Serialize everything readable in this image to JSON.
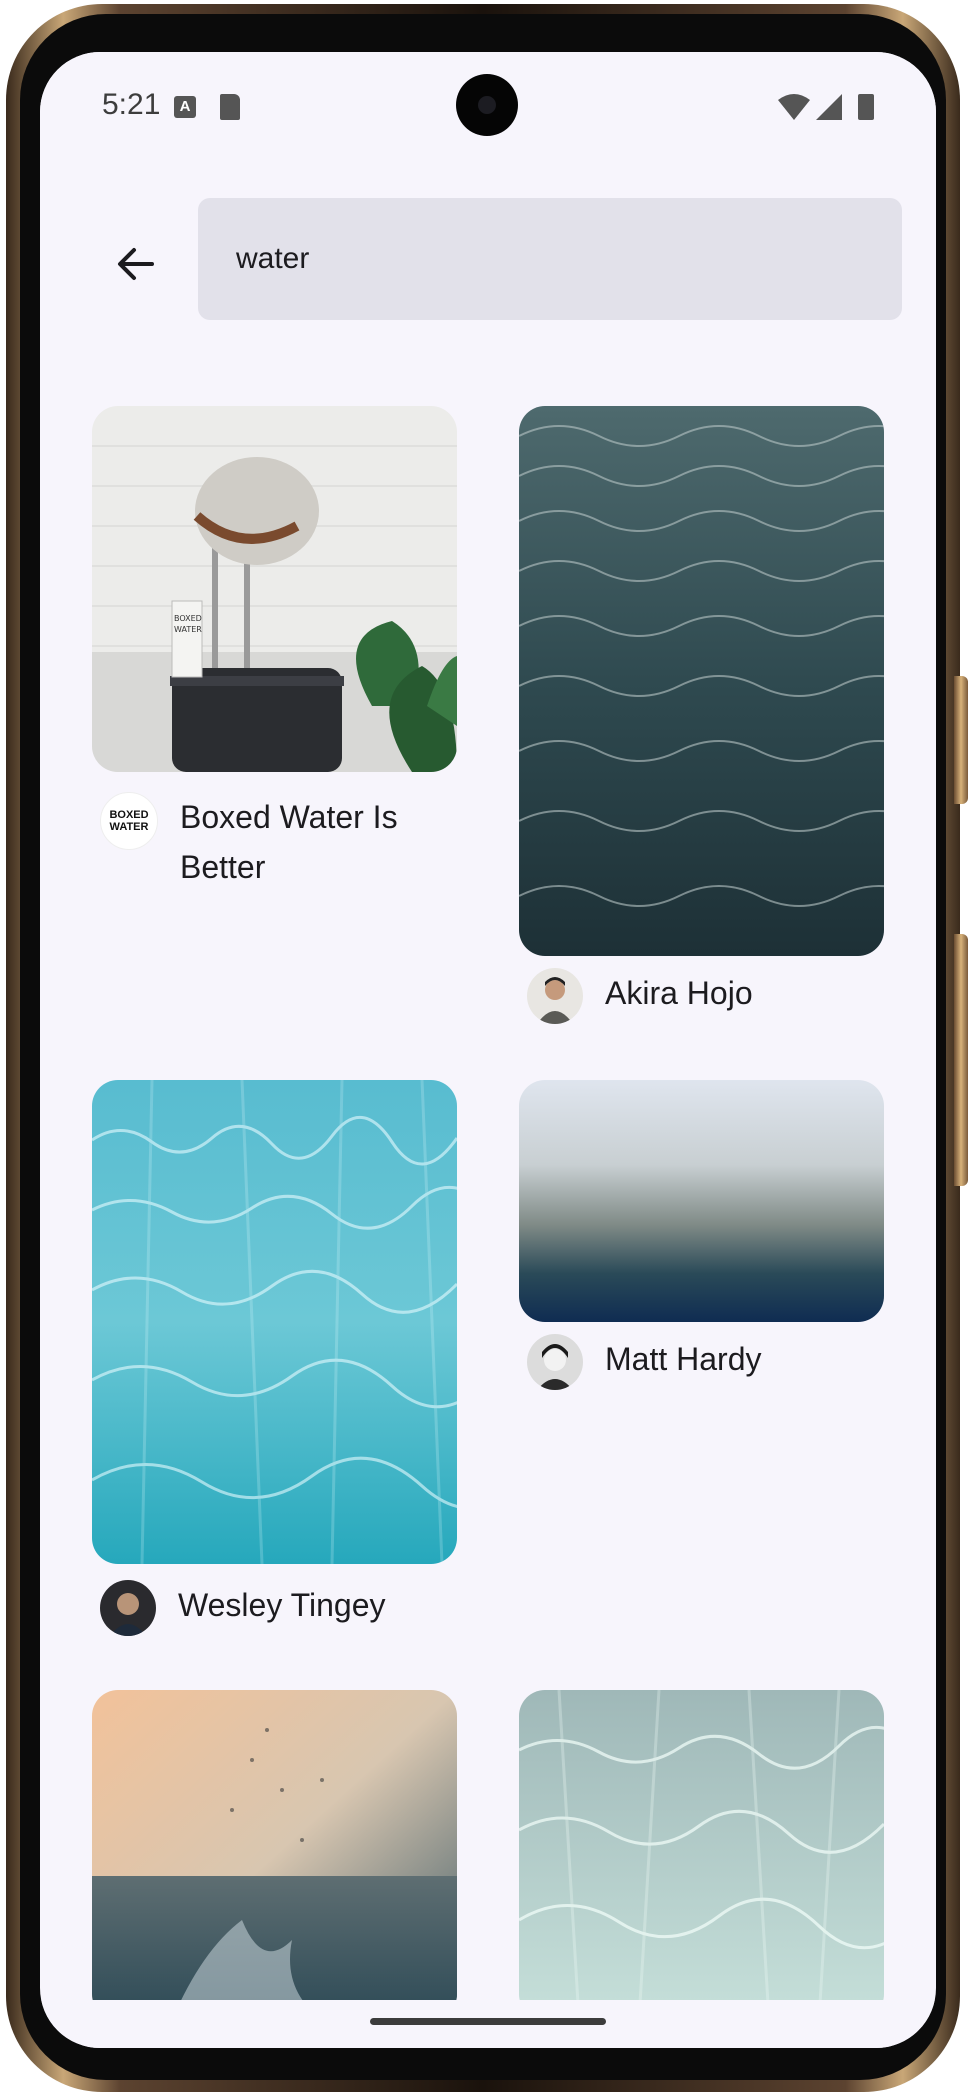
{
  "status_bar": {
    "time": "5:21",
    "notification_icons": [
      "a-icon",
      "sd-card-icon"
    ],
    "system_icons": [
      "wifi-icon",
      "signal-icon",
      "battery-icon"
    ]
  },
  "search": {
    "value": "water",
    "back_icon": "arrow-back-icon"
  },
  "results": [
    {
      "author": "Boxed Water Is Better",
      "avatar_text": "BOXED WATER",
      "image": "hat and suitcase with boxed water carton"
    },
    {
      "author": "Akira Hojo",
      "image": "dark ocean waves"
    },
    {
      "author": "Wesley Tingey",
      "image": "turquoise pool water"
    },
    {
      "author": "Matt Hardy",
      "image": "blurred gradient sea"
    },
    {
      "author": "",
      "image": "water splash at sunset"
    },
    {
      "author": "",
      "image": "clear shallow water"
    }
  ],
  "colors": {
    "background": "#f7f5fc",
    "search_field": "#e2e1ea",
    "text": "#1c1b1f"
  }
}
